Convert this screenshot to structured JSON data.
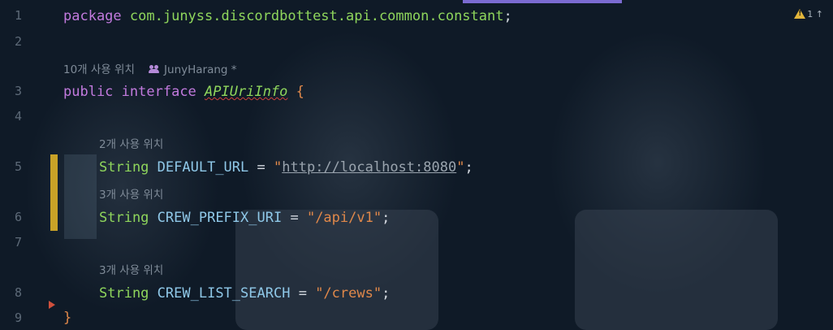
{
  "editor": {
    "warning_count": "1",
    "up_arrow": "↑",
    "line_numbers": [
      "1",
      "2",
      "3",
      "4",
      "5",
      "6",
      "7",
      "8",
      "9"
    ],
    "code": {
      "line1": {
        "kw": "package",
        "pkg": "com.junyss.discordbottest.api.common.constant",
        "semi": ";"
      },
      "line3": {
        "kw1": "public",
        "kw2": "interface",
        "name": "APIUriInfo",
        "brace": "{"
      },
      "line5": {
        "type": "String",
        "name": "DEFAULT_URL",
        "eq": "=",
        "q1": "\"",
        "url": "http://localhost:8080",
        "q2": "\"",
        "semi": ";"
      },
      "line6": {
        "type": "String",
        "name": "CREW_PREFIX_URI",
        "eq": "=",
        "value": "\"/api/v1\"",
        "semi": ";"
      },
      "line8": {
        "type": "String",
        "name": "CREW_LIST_SEARCH",
        "eq": "=",
        "value": "\"/crews\"",
        "semi": ";"
      },
      "line9": {
        "brace": "}"
      }
    },
    "hints": {
      "interface_usages": "10개 사용 위치",
      "author": "JunyHarang *",
      "default_url_usages": "2개 사용 위치",
      "crew_prefix_usages": "3개 사용 위치",
      "crew_list_usages": "3개 사용 위치"
    },
    "colors": {
      "keyword": "#c27ade",
      "type": "#8fd65c",
      "string": "#e0884a",
      "constant": "#8fc8e8",
      "change_marker": "#c9a227",
      "background": "#0f1a27"
    }
  }
}
